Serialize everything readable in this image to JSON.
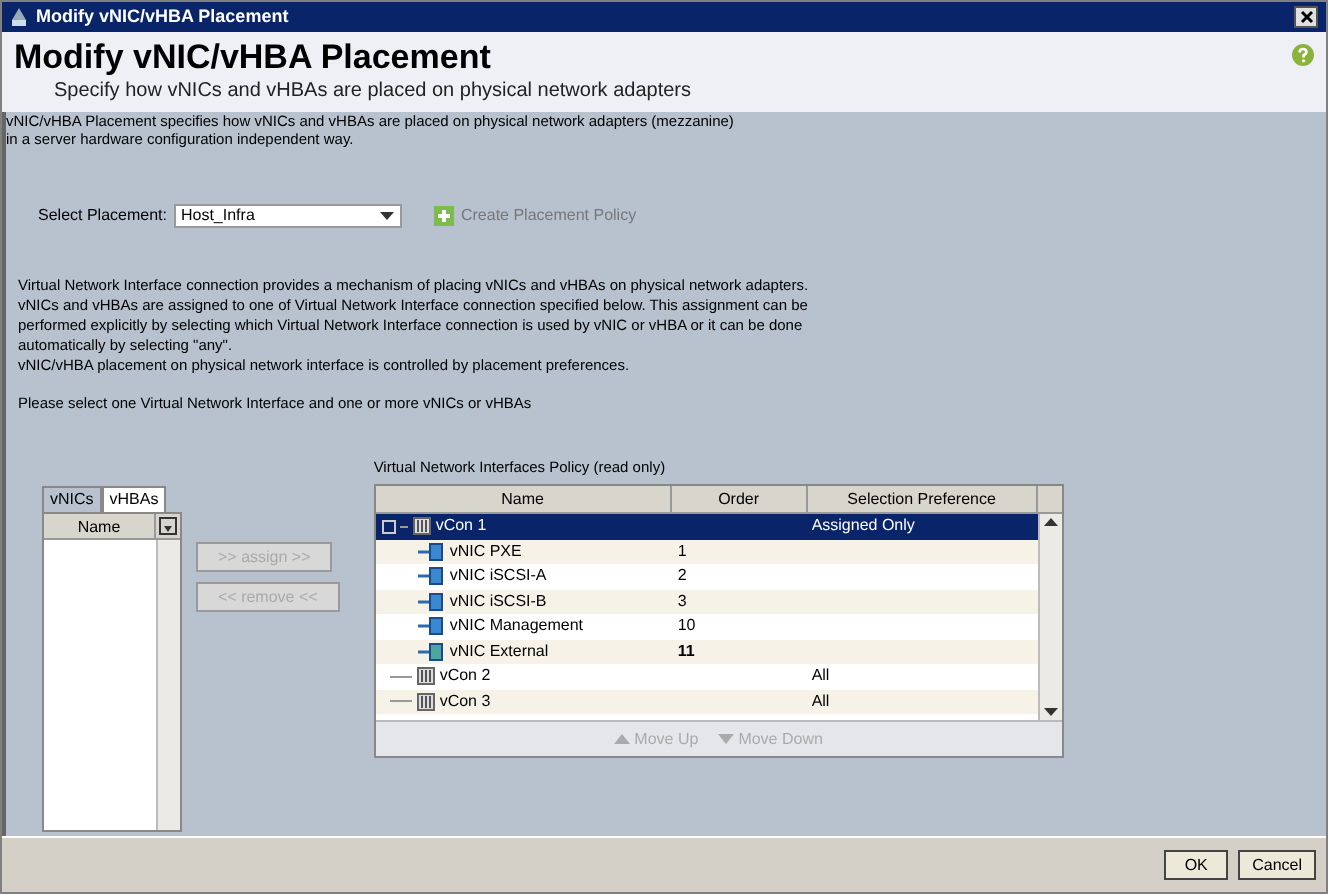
{
  "window": {
    "title": "Modify vNIC/vHBA Placement"
  },
  "header": {
    "title": "Modify vNIC/vHBA Placement",
    "subtitle": "Specify how vNICs and vHBAs are placed on physical network adapters"
  },
  "description": [
    "vNIC/vHBA Placement specifies how vNICs and vHBAs are placed on physical network adapters (mezzanine)",
    "in a server hardware configuration independent way."
  ],
  "placement": {
    "label": "Select Placement:",
    "value": "Host_Infra"
  },
  "create_policy": {
    "label": "Create Placement Policy",
    "disabled": true
  },
  "info_lines": [
    "Virtual Network Interface connection provides a mechanism of placing vNICs and vHBAs on physical network adapters.",
    "vNICs and vHBAs are assigned to one of Virtual Network Interface connection specified below. This assignment can be",
    "performed explicitly by selecting which Virtual Network Interface connection is used by vNIC or vHBA or it can be done",
    "automatically by selecting \"any\".",
    "vNIC/vHBA placement on physical network interface is controlled by placement preferences."
  ],
  "instruction": "Please select one Virtual Network Interface and one or more vNICs or vHBAs",
  "list_tabs": [
    {
      "label": "vNICs",
      "selected": false
    },
    {
      "label": "vHBAs",
      "selected": true
    }
  ],
  "list_columns": [
    "Name"
  ],
  "assign_buttons": [
    {
      "label": ">> assign >>",
      "disabled": true
    },
    {
      "label": "<< remove <<",
      "disabled": true
    }
  ],
  "policy": {
    "title": "Virtual Network Interfaces Policy (read only)",
    "columns": [
      "Name",
      "Order",
      "Selection Preference"
    ],
    "rows": [
      {
        "kind": "vcon",
        "name": "vCon 1",
        "preference": "Assigned Only",
        "expanded": true,
        "selected": true,
        "children": [
          {
            "kind": "vnic",
            "name": "vNIC PXE",
            "order": "1",
            "bold": false,
            "selected": false
          },
          {
            "kind": "vnic",
            "name": "vNIC iSCSI-A",
            "order": "2",
            "bold": false,
            "selected": false
          },
          {
            "kind": "vnic",
            "name": "vNIC iSCSI-B",
            "order": "3",
            "bold": false,
            "selected": false
          },
          {
            "kind": "vnic",
            "name": "vNIC Management",
            "order": "10",
            "bold": false,
            "selected": false
          },
          {
            "kind": "vnic",
            "name": "vNIC External",
            "order": "11",
            "bold": true,
            "selected": false
          }
        ]
      },
      {
        "kind": "vcon",
        "name": "vCon 2",
        "preference": "All",
        "expanded": false,
        "selected": false
      },
      {
        "kind": "vcon",
        "name": "vCon 3",
        "preference": "All",
        "expanded": false,
        "selected": false
      }
    ],
    "buttons": [
      {
        "label": "Move Up",
        "kind": "up",
        "disabled": true
      },
      {
        "label": "Move Down",
        "kind": "down",
        "disabled": true
      }
    ]
  },
  "buttons": [
    {
      "label": "OK"
    },
    {
      "label": "Cancel"
    }
  ]
}
